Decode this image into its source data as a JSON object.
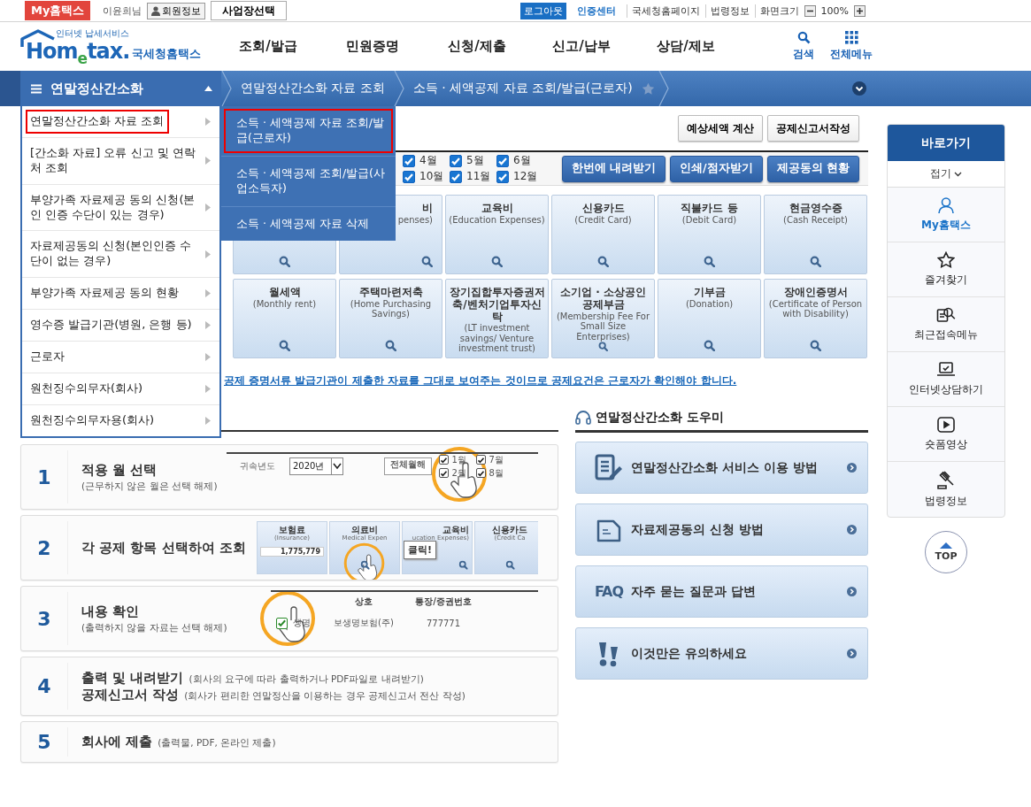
{
  "topbar": {
    "my_button": "My홈택스",
    "user": "이윤희님",
    "member_button": "회원정보",
    "workplace_button": "사업장선택",
    "logout": "로그아웃",
    "cert_center": "인증센터",
    "links": [
      "국세청홈페이지",
      "법령정보"
    ],
    "zoom_label": "화면크기",
    "zoom_value": "100%"
  },
  "header": {
    "logo_tagline": "인터넷 납세서비스",
    "logo": "Hom$_{e}$tax.",
    "logo_name": "국세청홈택스",
    "nav": [
      "조회/발급",
      "민원증명",
      "신청/제출",
      "신고/납부",
      "상담/제보"
    ],
    "search": "검색",
    "all_menu": "전체메뉴"
  },
  "menubar": {
    "title": "연말정산간소화",
    "expanded": true,
    "breadcrumbs": [
      "연말정산간소화 자료 조회",
      "소득 · 세액공제 자료 조회/발급(근로자)"
    ],
    "favorite": false
  },
  "menu": {
    "items": [
      {
        "label": "연말정산간소화 자료 조회",
        "selected": true
      },
      {
        "label": "[간소화 자료] 오류 신고 및 연락처 조회",
        "selected": false
      },
      {
        "label": "부양가족 자료제공 동의 신청(본인 인증 수단이 있는 경우)",
        "selected": false
      },
      {
        "label": "자료제공동의 신청(본인인증 수단이 없는 경우)",
        "selected": false
      },
      {
        "label": "부양가족 자료제공 동의 현황",
        "selected": false
      },
      {
        "label": "영수증 발급기관(병원, 은행 등)",
        "selected": false
      },
      {
        "label": "근로자",
        "selected": false
      },
      {
        "label": "원천징수의무자(회사)",
        "selected": false
      },
      {
        "label": "원천징수의무자용(회사)",
        "selected": false
      }
    ]
  },
  "submenu": {
    "items": [
      {
        "label": "소득 · 세액공제 자료 조회/발급(근로자)",
        "selected": true
      },
      {
        "label": "소득 · 세액공제 조회/발급(사업소득자)",
        "selected": false
      },
      {
        "label": "소득 · 세액공제 자료 삭제",
        "selected": false
      }
    ]
  },
  "actions": [
    "예상세액 계산",
    "공제신고서작성"
  ],
  "months": [
    {
      "label": "4월",
      "checked": true
    },
    {
      "label": "5월",
      "checked": true
    },
    {
      "label": "6월",
      "checked": true
    },
    {
      "label": "10월",
      "checked": true
    },
    {
      "label": "11월",
      "checked": true
    },
    {
      "label": "12월",
      "checked": true
    }
  ],
  "download_buttons": [
    "한번에 내려받기",
    "인쇄/점자받기",
    "제공동의 현황"
  ],
  "cards": [
    {
      "kind": "covered"
    },
    {
      "kind": "partial",
      "title": "비",
      "subtitle": "penses)"
    },
    {
      "kind": "full",
      "title": "교육비",
      "subtitle": "(Education Expenses)"
    },
    {
      "kind": "full",
      "title": "신용카드",
      "subtitle": "(Credit Card)"
    },
    {
      "kind": "full",
      "title": "직불카드 등",
      "subtitle": "(Debit Card)"
    },
    {
      "kind": "full",
      "title": "현금영수증",
      "subtitle": "(Cash Receipt)"
    },
    {
      "kind": "full",
      "title": "월세액",
      "subtitle": "(Monthly rent)"
    },
    {
      "kind": "full",
      "title": "주택마련저축",
      "subtitle": "(Home Purchasing Savings)"
    },
    {
      "kind": "full",
      "title": "장기집합투자증권저축/벤처기업투자신탁",
      "subtitle": "(LT investment savings/ Venture investment trust)"
    },
    {
      "kind": "full",
      "title": "소기업 · 소상공인 공제부금",
      "subtitle": "(Membership Fee For Small Size Enterprises)"
    },
    {
      "kind": "full",
      "title": "기부금",
      "subtitle": "(Donation)"
    },
    {
      "kind": "full",
      "title": "장애인증명서",
      "subtitle": "(Certificate of Person with Disability)"
    }
  ],
  "notice_link": "공제 증명서류 발급기관이 제출한 자료를 그대로 보여주는 것이므로 공제요건은 근로자가 확인해야 합니다.",
  "steps": [
    {
      "number": "1",
      "kind": "stacked",
      "lines": [
        {
          "title": "적용 월 선택",
          "note": "(근무하지 않은 월은 선택 해제)"
        }
      ],
      "illustration": {
        "kind": "months",
        "label": "귀속년도",
        "year": "2020년",
        "button": "전체월해",
        "checks": [
          {
            "label": "1월",
            "checked": true
          },
          {
            "label": "7월",
            "checked": true
          },
          {
            "label": "2월",
            "checked": true
          },
          {
            "label": "8월",
            "checked": true
          }
        ]
      }
    },
    {
      "number": "2",
      "kind": "stacked",
      "lines": [
        {
          "title": "각 공제 항목 선택하여 조회"
        }
      ],
      "illustration": {
        "kind": "cards",
        "callout": "클릭!",
        "cards": [
          {
            "title": "보험료",
            "subtitle": "(Insurance)",
            "amount": "1,775,779"
          },
          {
            "title": "의료비",
            "subtitle": "Medical Expen"
          },
          {
            "title": "교육비",
            "subtitle": "ucation Expenses)"
          },
          {
            "title": "신용카드",
            "subtitle": "(Credit Ca"
          }
        ]
      }
    },
    {
      "number": "3",
      "kind": "stacked",
      "lines": [
        {
          "title": "내용 확인",
          "note": "(출력하지 않을 자료는 선택 해제)"
        }
      ],
      "illustration": {
        "kind": "table",
        "columns": [
          "상호",
          "통장/증권번호"
        ],
        "row": {
          "checked": true,
          "type": "생명",
          "company": "보생명보험(주)",
          "account": "777771"
        }
      }
    },
    {
      "number": "4",
      "kind": "inline",
      "lines": [
        {
          "title": "출력 및 내려받기",
          "note": "(회사의 요구에 따라 출력하거나 PDF파일로 내려받기)"
        },
        {
          "title": "공제신고서 작성",
          "note": "(회사가 편리한 연말정산을 이용하는 경우 공제신고서 전산 작성)"
        }
      ]
    },
    {
      "number": "5",
      "kind": "inline",
      "lines": [
        {
          "title": "회사에 제출",
          "note": "(출력물, PDF, 온라인 제출)"
        }
      ]
    }
  ],
  "helper": {
    "title": "연말정산간소화 도우미",
    "items": [
      {
        "kind": "guide",
        "label": "연말정산간소화 서비스 이용 방법"
      },
      {
        "kind": "document",
        "label": "자료제공동의 신청 방법"
      },
      {
        "kind": "faq",
        "badge": "FAQ",
        "label": "자주 묻는 질문과 답변"
      },
      {
        "kind": "notice",
        "label": "이것만은 유의하세요"
      }
    ]
  },
  "sidebar": {
    "title": "바로가기",
    "collapse": "접기",
    "items": [
      {
        "kind": "user",
        "label": "My홈택스",
        "selected": true
      },
      {
        "kind": "star",
        "label": "즐겨찾기",
        "selected": false
      },
      {
        "kind": "recent",
        "label": "최근접속메뉴",
        "selected": false
      },
      {
        "kind": "consult",
        "label": "인터넷상담하기",
        "selected": false
      },
      {
        "kind": "video",
        "label": "숏폼영상",
        "selected": false
      },
      {
        "kind": "law",
        "label": "법령정보",
        "selected": false
      }
    ],
    "top": "TOP"
  }
}
